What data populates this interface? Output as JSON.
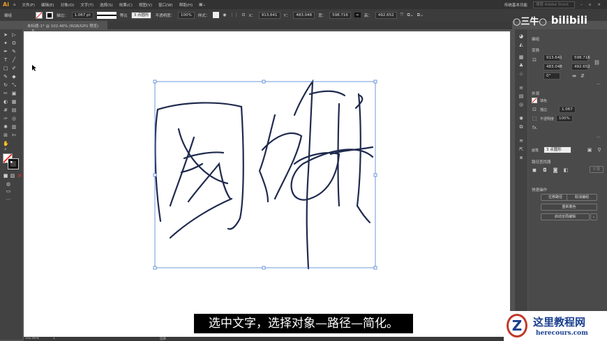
{
  "menubar": {
    "logo": "Ai",
    "items": [
      "文件(F)",
      "编辑(E)",
      "对象(O)",
      "文字(T)",
      "选择(S)",
      "效果(C)",
      "视图(V)",
      "窗口(W)",
      "帮助(H)"
    ],
    "workspace": "传统基本功能",
    "search_placeholder": "搜索 Adobe Stock"
  },
  "control": {
    "mode": "编组",
    "stroke_label": "描边：",
    "stroke_value": "1.067 pt",
    "brush_label": "等比",
    "brush_value": "3 点圆形",
    "opacity_label": "不透明度：",
    "opacity_value": "100%",
    "style_label": "样式：",
    "x_label": "X：",
    "x": "913.641",
    "y_label": "Y：",
    "y": "483.048",
    "w_label": "宽：",
    "w": "598.716",
    "h_label": "高：",
    "h": "492.652"
  },
  "document_tab": {
    "title": "未标题-1* @ 102.46% (RGB/GPU 预览)",
    "close": "×"
  },
  "properties": {
    "section": "编组",
    "transform": "变换",
    "x": "913.641",
    "y": "483.048",
    "w": "598.716",
    "h": "492.652",
    "angle": "0°",
    "appearance": "外观",
    "fill": "填色",
    "stroke": "描边",
    "stroke_value": "1.067",
    "opacity_label": "不透明度",
    "opacity": "100%",
    "fx": "fx.",
    "brush_label": "画笔",
    "brush": "3 点圆形",
    "pathfinder": "路径查找器",
    "expand": "扩展",
    "quick_actions": "快速操作",
    "offset_path": "位移路径",
    "ungroup": "取消编组",
    "recolor": "重新着色",
    "global_edit": "启动全局编辑",
    "more": "..."
  },
  "status": {
    "zoom": "102.46%",
    "page": "1",
    "tool": "选择"
  },
  "subtitle": "选中文字，选择对象—路径—简化。",
  "overlay": {
    "channel": "○三牛○",
    "site": "bilibili",
    "watermark_title": "这里教程网",
    "watermark_url": "herecours.com"
  },
  "colors": {
    "stroke": "#1f2a4e",
    "selection": "#4a7fd4"
  }
}
